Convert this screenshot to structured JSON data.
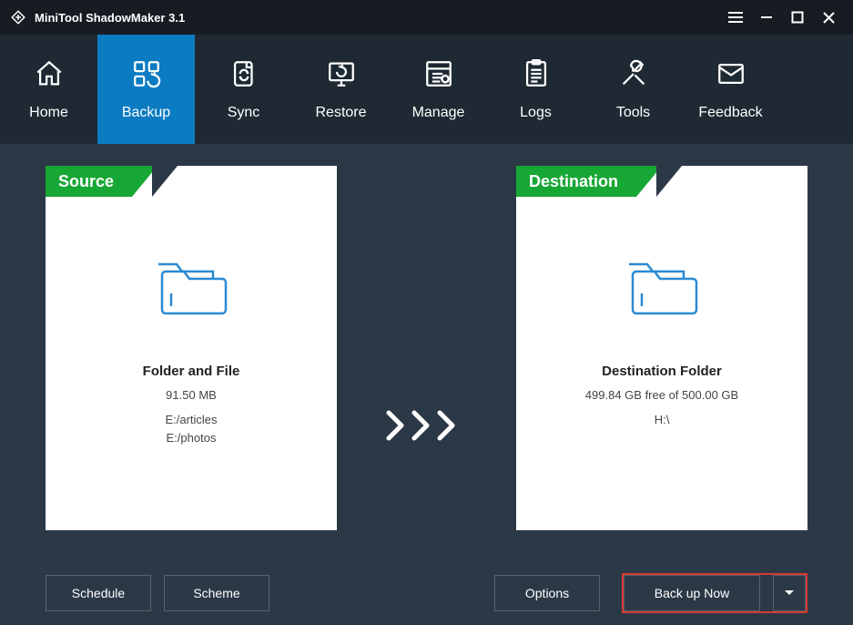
{
  "app": {
    "title": "MiniTool ShadowMaker 3.1"
  },
  "nav": {
    "items": [
      {
        "label": "Home",
        "icon": "home",
        "active": false
      },
      {
        "label": "Backup",
        "icon": "backup",
        "active": true
      },
      {
        "label": "Sync",
        "icon": "sync",
        "active": false
      },
      {
        "label": "Restore",
        "icon": "restore",
        "active": false
      },
      {
        "label": "Manage",
        "icon": "manage",
        "active": false
      },
      {
        "label": "Logs",
        "icon": "logs",
        "active": false
      },
      {
        "label": "Tools",
        "icon": "tools",
        "active": false
      },
      {
        "label": "Feedback",
        "icon": "feedback",
        "active": false
      }
    ]
  },
  "source": {
    "header": "Source",
    "title": "Folder and File",
    "size": "91.50 MB",
    "paths": [
      "E:/articles",
      "E:/photos"
    ]
  },
  "destination": {
    "header": "Destination",
    "title": "Destination Folder",
    "free": "499.84 GB free of 500.00 GB",
    "path": "H:\\"
  },
  "buttons": {
    "schedule": "Schedule",
    "scheme": "Scheme",
    "options": "Options",
    "backup_now": "Back up Now"
  }
}
